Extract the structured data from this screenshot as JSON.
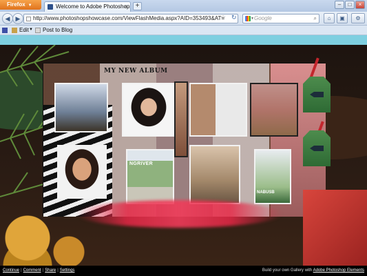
{
  "browser": {
    "app_button": "Firefox",
    "tab_title": "Welcome to Adobe Photoshop ...",
    "new_tab_symbol": "+",
    "url": "http://www.photoshopshowcase.com/ViewFlashMedia.aspx?AID=353493&AT=",
    "search_placeholder": "Google",
    "bookmarks": {
      "edit_label": "Edit",
      "post_label": "Post to Blog"
    }
  },
  "album": {
    "title": "MY NEW ALBUM",
    "photo_captions": [
      "NGRIVER",
      "NABUSB"
    ]
  },
  "footer": {
    "links": [
      "Continue",
      "Comment",
      "Share",
      "Settings"
    ],
    "build_text": "Build your own Gallery with",
    "build_link": "Adobe Photoshop Elements"
  },
  "colors": {
    "page_strip": "#7ecfe0",
    "firefox_orange": "#e0731c",
    "chrome_blue": "#d4e0ef"
  }
}
